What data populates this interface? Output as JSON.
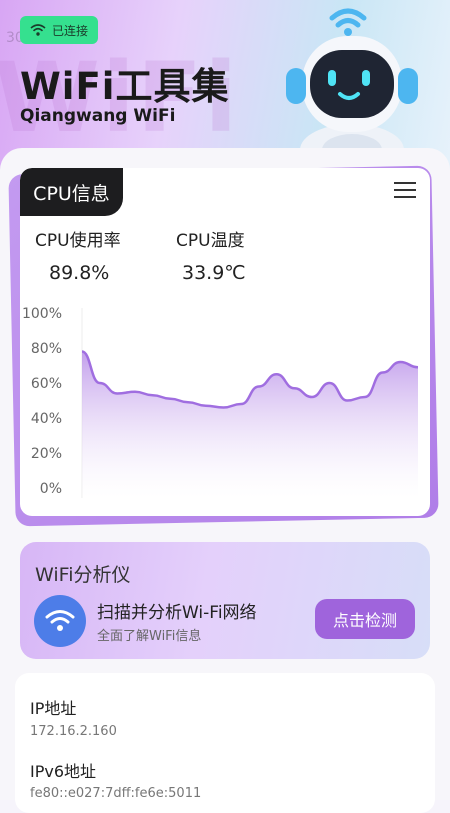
{
  "status": {
    "label": "已连接",
    "bg_number": "3086"
  },
  "app": {
    "title": "WiFi工具集",
    "subtitle": "Qiangwang WiFi",
    "bg_text": "WiFi"
  },
  "cpu": {
    "tab_label": "CPU信息",
    "usage_label": "CPU使用率",
    "usage_value": "89.8%",
    "temp_label": "CPU温度",
    "temp_value": "33.9℃"
  },
  "chart_data": {
    "type": "area",
    "y_ticks": [
      "100%",
      "80%",
      "60%",
      "40%",
      "20%",
      "0%"
    ],
    "ylim": [
      0,
      100
    ],
    "values": [
      78,
      60,
      54,
      55,
      53,
      51,
      49,
      47,
      46,
      48,
      58,
      65,
      57,
      52,
      60,
      50,
      52,
      66,
      72,
      69
    ],
    "line_color": "#a06ee0"
  },
  "wifi_analyzer": {
    "title": "WiFi分析仪",
    "scan_title": "扫描并分析Wi-Fi网络",
    "scan_subtitle": "全面了解WiFi信息",
    "check_button": "点击检测"
  },
  "network": {
    "ip_label": "IP地址",
    "ip_value": "172.16.2.160",
    "ipv6_label": "IPv6地址",
    "ipv6_value": "fe80::e027:7dff:fe6e:5011"
  },
  "colors": {
    "accent": "#9f64dc",
    "status": "#35e08f",
    "wifi_icon_bg": "#4d7de8"
  }
}
